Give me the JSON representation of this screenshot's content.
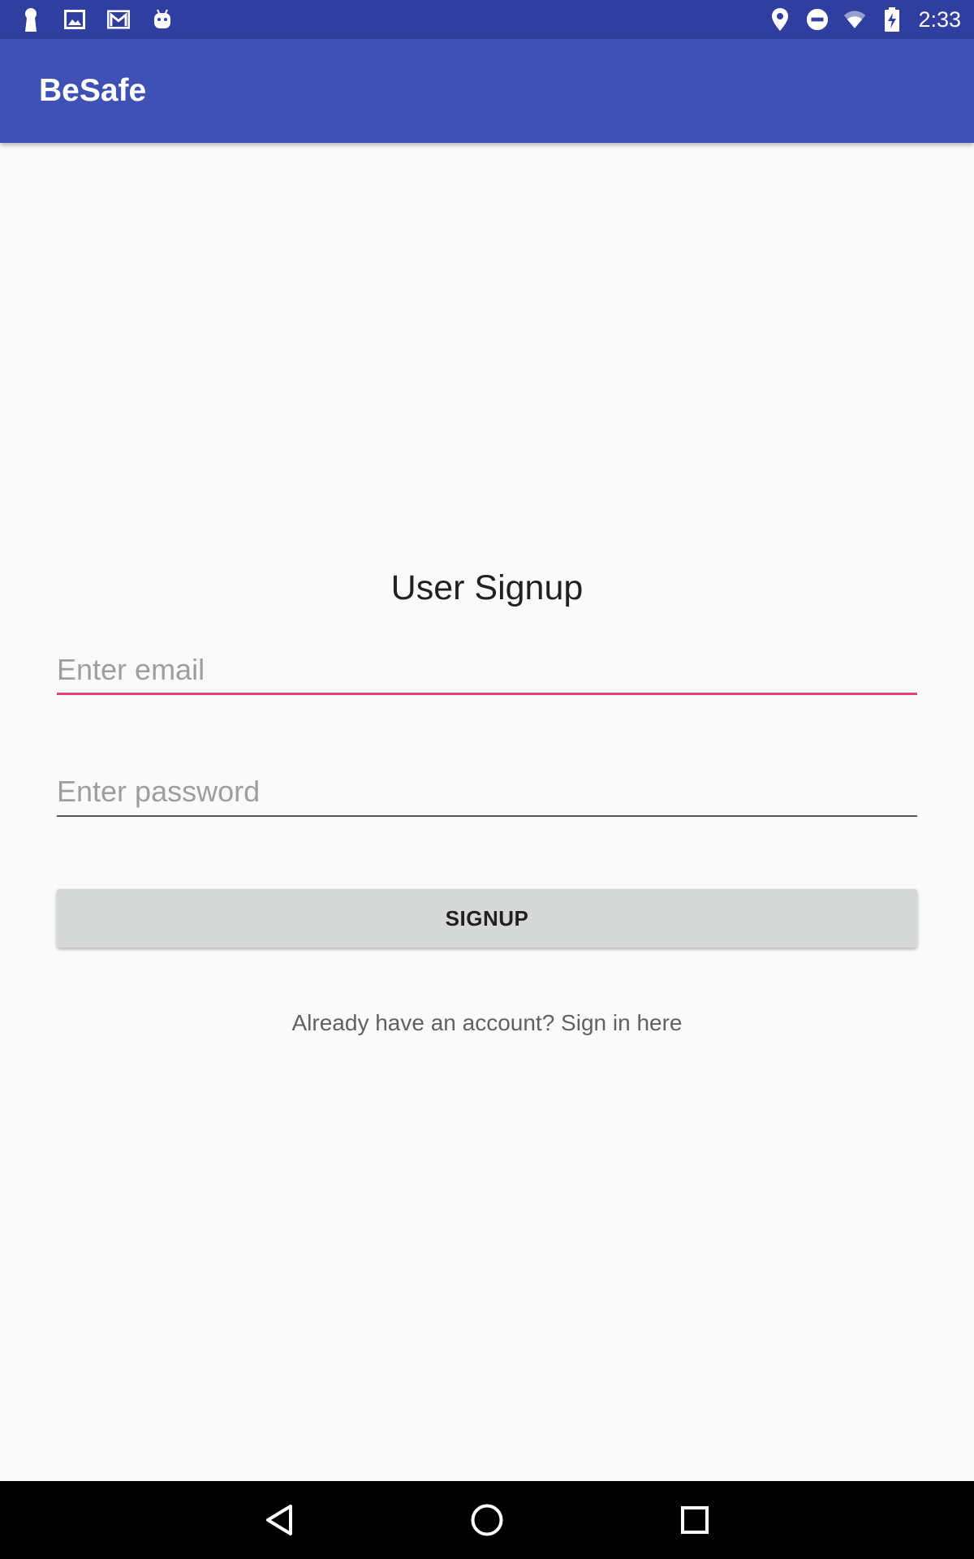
{
  "status_bar": {
    "time": "2:33",
    "left_icons": [
      "keyhole-icon",
      "image-icon",
      "gmail-icon",
      "android-icon"
    ],
    "right_icons": [
      "location-icon",
      "do-not-disturb-icon",
      "wifi-icon",
      "battery-charging-icon"
    ]
  },
  "app_bar": {
    "title": "BeSafe",
    "color": "#3f51b5",
    "status_color": "#303f9f"
  },
  "form": {
    "heading": "User Signup",
    "email": {
      "placeholder": "Enter email",
      "value": ""
    },
    "password": {
      "placeholder": "Enter password",
      "value": ""
    },
    "signup_label": "SIGNUP",
    "signin_link": "Already have an account? Sign in here",
    "accent_color": "#e91e63"
  },
  "nav_bar": {
    "buttons": [
      "back-icon",
      "home-icon",
      "recents-icon"
    ]
  }
}
